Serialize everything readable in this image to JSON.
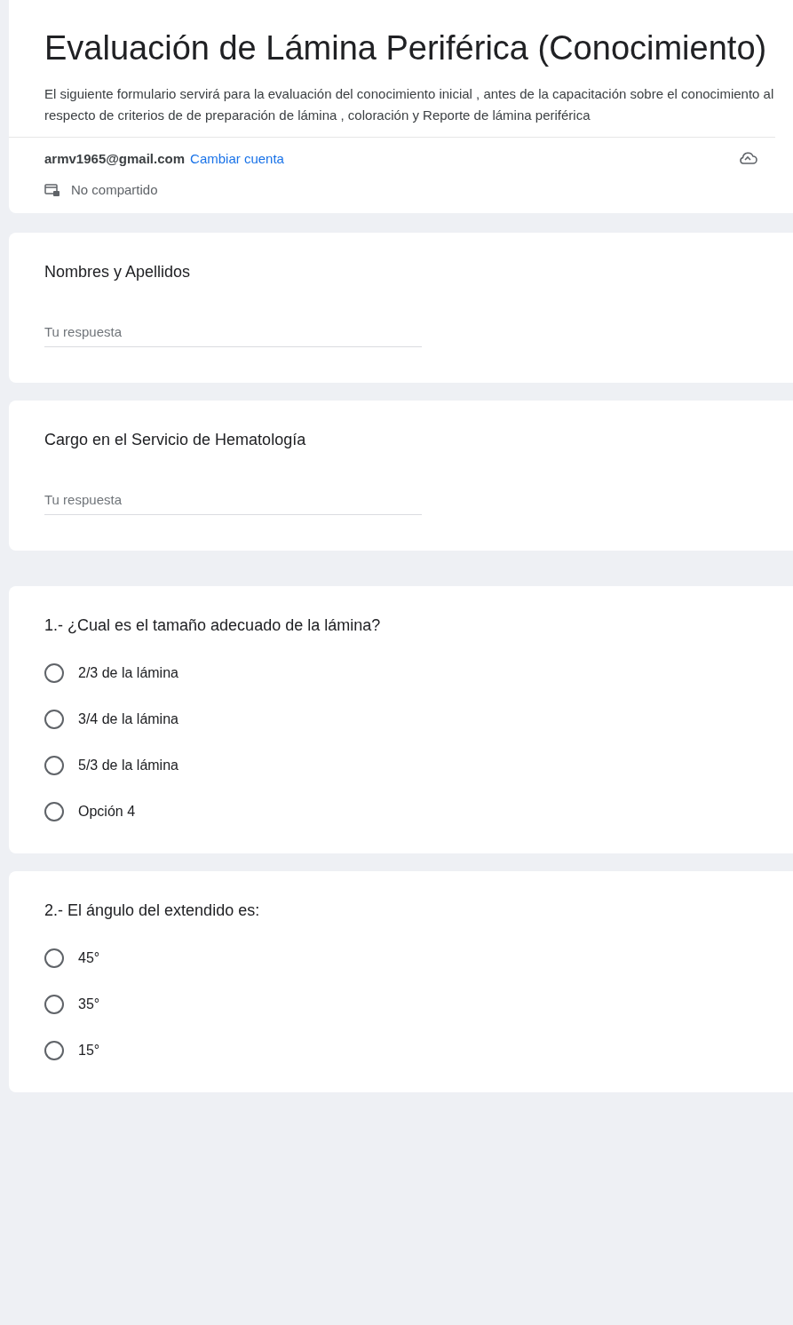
{
  "form": {
    "title": "Evaluación de Lámina Periférica (Conocimiento)",
    "description": "El siguiente formulario servirá para la evaluación del conocimiento inicial , antes de la capacitación sobre el conocimiento al respecto de criterios de de preparación de lámina , coloración y Reporte de lámina periférica"
  },
  "account": {
    "email": "armv1965@gmail.com",
    "switch_link": "Cambiar cuenta",
    "sharing_note": "No compartido"
  },
  "questions": [
    {
      "kind": "text",
      "title": "Nombres y Apellidos",
      "placeholder": "Tu respuesta"
    },
    {
      "kind": "text",
      "title": "Cargo en el Servicio de Hematología",
      "placeholder": "Tu respuesta"
    },
    {
      "kind": "radio",
      "title": "1.- ¿Cual es el tamaño adecuado de la lámina?",
      "options": [
        {
          "label": "2/3 de la lámina",
          "selected": false
        },
        {
          "label": "3/4 de la lámina",
          "selected": false
        },
        {
          "label": "5/3 de la lámina",
          "selected": false
        },
        {
          "label": "Opción 4",
          "selected": false
        }
      ]
    },
    {
      "kind": "radio",
      "title": "2.- El ángulo del extendido es:",
      "options": [
        {
          "label": "45°",
          "selected": false
        },
        {
          "label": "35°",
          "selected": false
        },
        {
          "label": "15°",
          "selected": false
        }
      ]
    }
  ]
}
